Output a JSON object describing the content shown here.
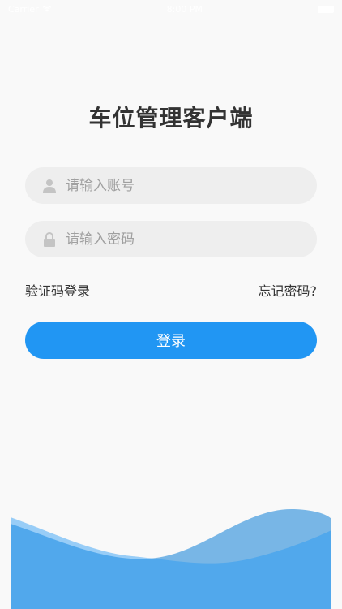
{
  "status_bar": {
    "carrier": "Carrier",
    "time": "8:00 PM",
    "wifi_icon": "wifi-icon",
    "battery_icon": "battery-icon"
  },
  "app_title": "车位管理客户端",
  "account": {
    "placeholder": "请输入账号",
    "value": "",
    "icon": "user-icon"
  },
  "password": {
    "placeholder": "请输入密码",
    "value": "",
    "icon": "lock-icon"
  },
  "links": {
    "sms_login": "验证码登录",
    "forgot_password": "忘记密码?"
  },
  "login_button": {
    "label": "登录"
  },
  "colors": {
    "background": "#f9f9f9",
    "input_bg": "#eeeeee",
    "accent": "#2196f3",
    "placeholder": "#a0a0a0",
    "wave_dark": "#57a5e1",
    "wave_light": "#b5d8f3"
  }
}
